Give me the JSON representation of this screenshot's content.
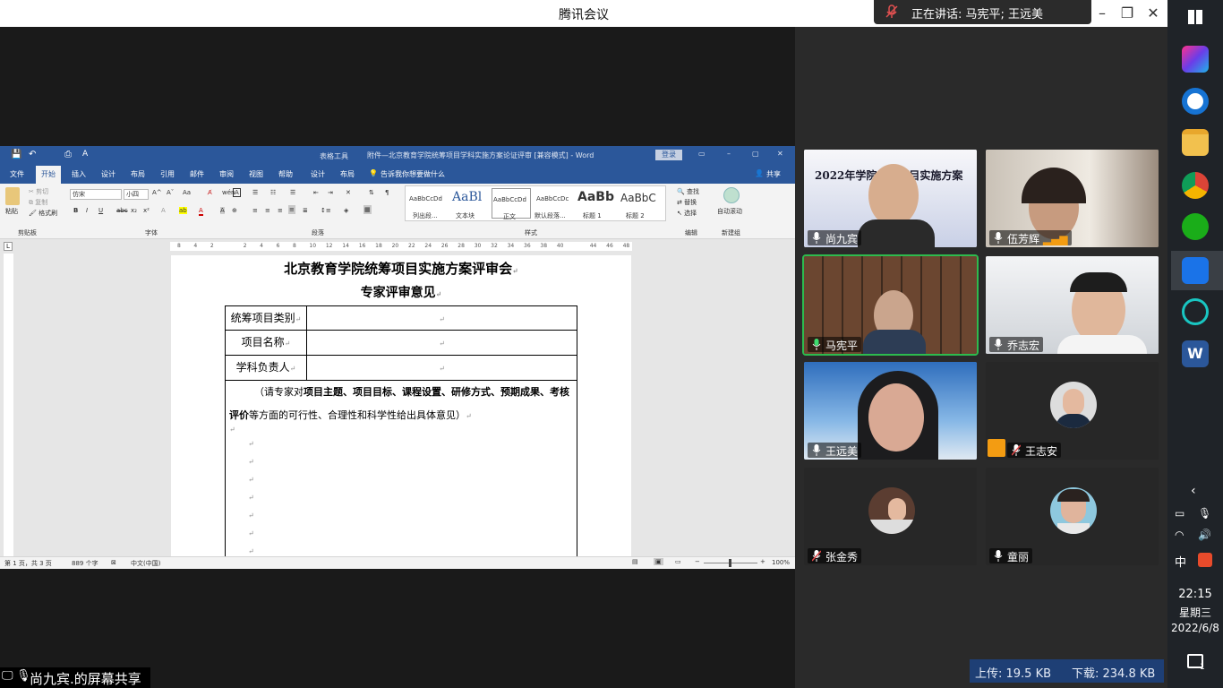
{
  "window": {
    "title": "腾讯会议",
    "speaking": "正在讲话: 马宪平; 王远美"
  },
  "word": {
    "doc_title": "附件—北京教育学院统筹项目学科实施方案论证评审 [兼容模式] - Word",
    "table_tools": "表格工具",
    "login": "登录",
    "tabs": [
      "文件",
      "开始",
      "插入",
      "设计",
      "布局",
      "引用",
      "邮件",
      "审阅",
      "视图",
      "帮助",
      "设计",
      "布局"
    ],
    "tell_me": "告诉我你想要做什么",
    "share": "共享",
    "ribbon": {
      "clipboard": {
        "paste": "粘贴",
        "cut": "剪切",
        "copy": "复制",
        "format_painter": "格式刷",
        "group": "剪贴板"
      },
      "font": {
        "name": "仿宋",
        "size": "小四",
        "group": "字体"
      },
      "paragraph": {
        "group": "段落"
      },
      "styles": {
        "group": "样式",
        "items": [
          {
            "preview": "AaBbCcDd",
            "name": "列出段..."
          },
          {
            "preview": "AaBl",
            "name": "文本块"
          },
          {
            "preview": "AaBbCcDd",
            "name": "正文"
          },
          {
            "preview": "AaBbCcDc",
            "name": "默认段落..."
          },
          {
            "preview": "AaBb",
            "name": "标题 1"
          },
          {
            "preview": "AaBbC",
            "name": "标题 2"
          }
        ]
      },
      "editing": {
        "find": "查找",
        "replace": "替换",
        "select": "选择",
        "group": "编辑"
      },
      "new_group": {
        "label": "自动滚动",
        "group": "新建组"
      }
    },
    "ruler_ticks": [
      "8",
      "4",
      "2",
      "",
      "2",
      "4",
      "6",
      "8",
      "10",
      "12",
      "14",
      "16",
      "18",
      "20",
      "22",
      "24",
      "26",
      "28",
      "30",
      "32",
      "34",
      "36",
      "38",
      "40",
      "",
      "44",
      "46",
      "48"
    ],
    "document": {
      "heading": "北京教育学院统筹项目实施方案评审会",
      "subheading": "专家评审意见",
      "rows": [
        {
          "label": "统筹项目类别"
        },
        {
          "label": "项目名称"
        },
        {
          "label": "学科负责人"
        }
      ],
      "instruction_prefix": "（请专家对",
      "instruction_bold": "项目主题、项目目标、课程设置、研修方式、预期成果、考核评价",
      "instruction_suffix": "等方面的可行性、合理性和科学性给出具体意见）",
      "return_mark": "↵"
    },
    "status": {
      "page": "第 1 页，共 3 页",
      "words": "889 个字",
      "lang": "中文(中国)",
      "zoom": "100%"
    }
  },
  "participants": [
    {
      "name": "尚九宾",
      "slide_text": "2022年学院统筹项目实施方案"
    },
    {
      "name": "伍芳辉"
    },
    {
      "name": "马宪平",
      "active": true
    },
    {
      "name": "乔志宏"
    },
    {
      "name": "王远美"
    },
    {
      "name": "王志安"
    },
    {
      "name": "张金秀"
    },
    {
      "name": "童丽"
    }
  ],
  "footer": {
    "share_label": "尚九宾.的屏幕共享"
  },
  "network": {
    "upload": "上传: 19.5 KB",
    "download": "下载: 234.8 KB"
  },
  "taskbar": {
    "ime": "中",
    "time": "22:15",
    "weekday": "星期三",
    "date": "2022/6/8",
    "notif_count": "1"
  },
  "colors": {
    "word_blue": "#2b579a",
    "active_green": "#2dbb4e",
    "bg": "#1e1e1e"
  }
}
